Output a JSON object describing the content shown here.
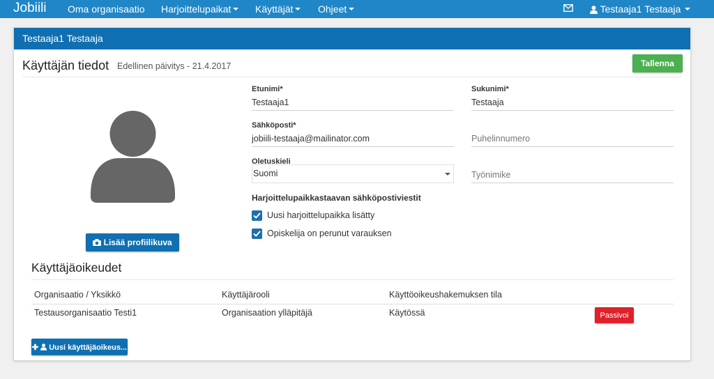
{
  "navbar": {
    "brand": "Jobiili",
    "links": [
      {
        "label": "Oma organisaatio"
      },
      {
        "label": "Harjoittelupaikat"
      },
      {
        "label": "Käyttäjät"
      },
      {
        "label": "Ohjeet"
      }
    ],
    "user_label": "Testaaja1 Testaaja",
    "mail_icon": "envelope-icon",
    "user_icon": "user-icon"
  },
  "panel": {
    "heading": "Testaaja1 Testaaja",
    "title": "Käyttäjän tiedot",
    "last_update": "Edellinen päivitys - 21.4.2017",
    "save_label": "Tallenna",
    "add_photo_label": "Lisää profiilikuva",
    "form": {
      "firstname_label": "Etunimi*",
      "firstname_value": "Testaaja1",
      "lastname_label": "Sukunimi*",
      "lastname_value": "Testaaja",
      "email_label": "Sähköposti*",
      "email_value": "jobiili-testaaja@mailinator.com",
      "phone_placeholder": "Puhelinnumero",
      "language_label": "Oletuskieli",
      "language_value": "Suomi",
      "jobtitle_placeholder": "Työnimike",
      "notifications_title": "Harjoittelupaikkastaavan sähköpostiviestit",
      "checkbox1_label": "Uusi harjoittelupaikka lisätty",
      "checkbox1_checked": true,
      "checkbox2_label": "Opiskelija on perunut varauksen",
      "checkbox2_checked": true
    },
    "rights": {
      "title": "Käyttäjäoikeudet",
      "columns": [
        "Organisaatio / Yksikkö",
        "Käyttäjärooli",
        "Käyttöoikeushakemuksen tila"
      ],
      "rows": [
        {
          "org": "Testausorganisaatio Testi1",
          "role": "Organisaation ylläpitäjä",
          "status": "Käytössä",
          "action": "Passivoi"
        }
      ],
      "new_label": "Uusi käyttäjäoikeus..."
    }
  },
  "colors": {
    "navbar": "#1f86c7",
    "panel_heading": "#0f6fb0",
    "save_button": "#4caf50",
    "passivate_button": "#e0202a"
  }
}
